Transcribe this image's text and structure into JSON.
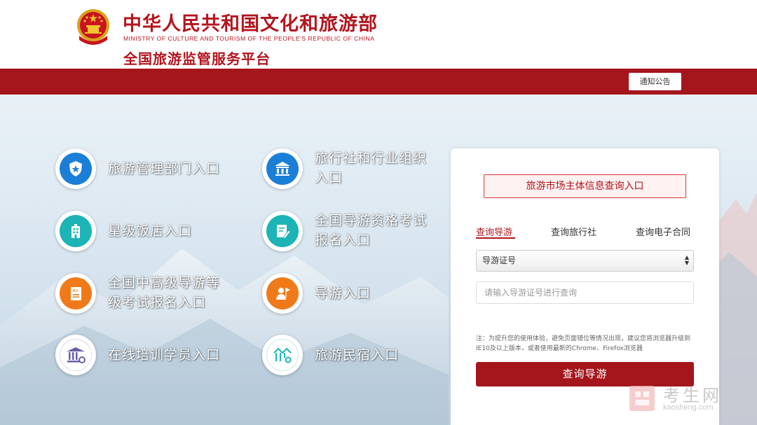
{
  "header": {
    "title_cn": "中华人民共和国文化和旅游部",
    "title_en": "MINISTRY OF CULTURE AND TOURISM OF THE PEOPLE'S REPUBLIC OF CHINA",
    "subtitle": "全国旅游监管服务平台",
    "notice_label": "通知公告"
  },
  "entries": [
    {
      "label": "旅游管理部门入口",
      "icon": "shield-star-icon"
    },
    {
      "label": "旅行社和行业组织入口",
      "icon": "building-icon"
    },
    {
      "label": "星级饭店入口",
      "icon": "hotel-icon"
    },
    {
      "label": "全国导游资格考试报名入口",
      "icon": "exam-edit-icon"
    },
    {
      "label": "全国中高级导游等级考试报名入口",
      "icon": "grade-document-icon"
    },
    {
      "label": "导游入口",
      "icon": "guide-flag-icon"
    },
    {
      "label": "在线培训学员入口",
      "icon": "training-hall-icon"
    },
    {
      "label": "旅游民宿入口",
      "icon": "homestay-icon"
    }
  ],
  "panel": {
    "entry_button": "旅游市场主体信息查询入口",
    "tabs": [
      "查询导游",
      "查询旅行社",
      "查询电子合同"
    ],
    "active_tab": "查询导游",
    "select_value": "导游证号",
    "input_placeholder": "请输入导游证号进行查询",
    "note": "注：为提升您的使用体验，避免页面错位等情况出现，建议您将浏览器升级到IE10及以上版本，或者使用最新的Chrome、Firefox浏览器",
    "submit_label": "查询导游"
  },
  "watermark": {
    "cn": "考生网",
    "en": "kaosheng.com"
  },
  "colors": {
    "brand_red": "#a5151c",
    "title_red": "#b3151e"
  }
}
